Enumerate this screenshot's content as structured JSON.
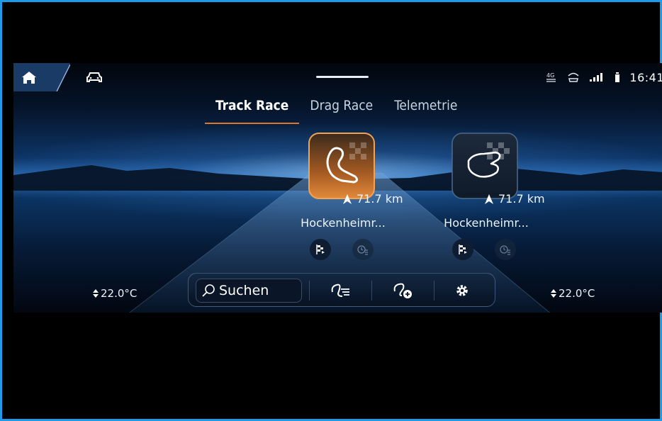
{
  "statusbar": {
    "network": "4G",
    "time": "16:41"
  },
  "tabs": [
    {
      "label": "Track Race",
      "active": true
    },
    {
      "label": "Drag Race",
      "active": false
    },
    {
      "label": "Telemetrie",
      "active": false
    }
  ],
  "tracks": [
    {
      "name": "Hockenheimr...",
      "distance": "71.7 km",
      "selected": true
    },
    {
      "name": "Hockenheimr...",
      "distance": "71.7 km",
      "selected": false
    }
  ],
  "climate": {
    "left_temp": "22.0°C",
    "right_temp": "22.0°C"
  },
  "dock": {
    "search_label": "Suchen"
  },
  "colors": {
    "accent": "#e27628",
    "frame": "#1e9be8",
    "background": "#000000"
  },
  "icons": [
    "home-icon",
    "car-icon",
    "network-4g-icon",
    "signal-strength-icon",
    "battery-icon",
    "track-circuit-icon",
    "checkered-flag-icon",
    "lap-timer-icon",
    "search-icon",
    "track-list-icon",
    "add-track-icon",
    "settings-gear-icon",
    "temperature-arrows-icon",
    "navigation-arrow-icon"
  ]
}
